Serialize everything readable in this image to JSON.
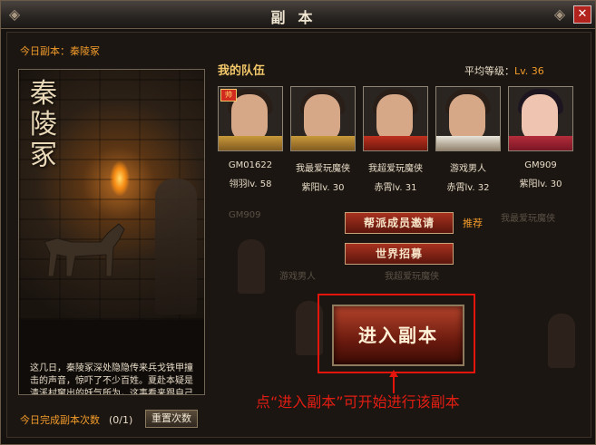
{
  "window": {
    "title": "副本",
    "close_glyph": "✕"
  },
  "today": {
    "label": "今日副本：秦陵冢"
  },
  "left_panel": {
    "art_title": "秦陵冢",
    "description": "这几日，秦陵冢深处隐隐传来兵戈铁甲撞击的声音，惊吓了不少百姓。夏赴本疑是清溪村窜出的妖气所为，这事看来跟自己当初误启魔盒有关，我这就去探寻一番。"
  },
  "footer": {
    "complete_label": "今日完成副本次数",
    "complete_count": "(0/1)",
    "reset_button": "重置次数"
  },
  "team": {
    "title": "我的队伍",
    "avg_label": "平均等级：",
    "avg_value": "Lv. 36",
    "members": [
      {
        "name": "GM01622",
        "level": "翎羽lv. 58",
        "leader": true,
        "flag": "帅"
      },
      {
        "name": "我最爱玩魔侠",
        "level": "紫阳lv. 30",
        "leader": false
      },
      {
        "name": "我超爱玩魔侠",
        "level": "赤霄lv. 31",
        "leader": false
      },
      {
        "name": "游戏男人",
        "level": "赤霄lv. 32",
        "leader": false
      },
      {
        "name": "GM909",
        "level": "紫阳lv. 30",
        "leader": false
      }
    ]
  },
  "ghost_text": {
    "a": "GM909",
    "b": "我最爱玩魔侠",
    "c": "游戏男人",
    "d": "我超爱玩魔侠"
  },
  "buttons": {
    "invite": "帮派成员邀请",
    "recommend": "推荐",
    "world_recruit": "世界招募",
    "enter": "进入副本"
  },
  "hint": "点“进入副本”可开始进行该副本",
  "colors": {
    "accent_orange": "#f29b2a",
    "highlight_red": "#e2140c",
    "gold": "#f3c86a"
  }
}
